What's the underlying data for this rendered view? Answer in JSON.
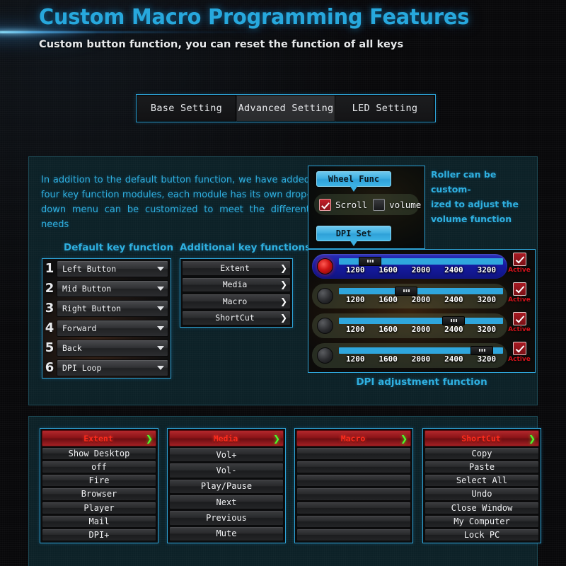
{
  "header": {
    "title": "Custom Macro Programming Features",
    "subtitle": "Custom button function, you can reset the function of all keys",
    "accent_color": "#27a8dd"
  },
  "tabs": [
    {
      "label": "Base Setting",
      "active": false
    },
    {
      "label": "Advanced Setting",
      "active": true
    },
    {
      "label": "LED Setting",
      "active": false
    }
  ],
  "main_panel": {
    "intro_text": "In addition to the default button function, we have added four key function modules, each module has its own drop-down menu can be customized to meet the different needs",
    "default_key_heading": "Default key function",
    "additional_key_heading": "Additional key functions",
    "default_keys": [
      {
        "number": "1",
        "value": "Left Button"
      },
      {
        "number": "2",
        "value": "Mid Button"
      },
      {
        "number": "3",
        "value": "Right Button"
      },
      {
        "number": "4",
        "value": "Forward"
      },
      {
        "number": "5",
        "value": "Back"
      },
      {
        "number": "6",
        "value": "DPI Loop"
      }
    ],
    "additional_functions": [
      {
        "label": "Extent",
        "chevron": "❯"
      },
      {
        "label": "Media",
        "chevron": "❯"
      },
      {
        "label": "Macro",
        "chevron": "❯"
      },
      {
        "label": "ShortCut",
        "chevron": "❯"
      }
    ]
  },
  "wheel_panel": {
    "wheel_button": "Wheel Func",
    "dpi_button": "DPI Set",
    "scroll_label": "Scroll",
    "volume_label": "volume",
    "scroll_checked": true,
    "volume_checked": false,
    "note": "Roller can be custom-ized to adjust the volume function",
    "note_lines": [
      "Roller can be custom-",
      "ized to adjust the",
      "volume function"
    ]
  },
  "dpi_panel": {
    "caption": "DPI adjustment function",
    "tick_labels": [
      "1200",
      "1600",
      "2000",
      "2400",
      "3200"
    ],
    "active_label": "Active",
    "rows": [
      {
        "selected": true,
        "value": "1200",
        "handle_pct": 12,
        "active": true
      },
      {
        "selected": false,
        "value": "1600",
        "handle_pct": 34,
        "active": true
      },
      {
        "selected": false,
        "value": "2400",
        "handle_pct": 63,
        "active": true
      },
      {
        "selected": false,
        "value": "3200",
        "handle_pct": 80,
        "active": true
      }
    ]
  },
  "menu_columns": [
    {
      "title": "Extent",
      "chevron": "❯",
      "truncated": true,
      "items": [
        "Show Desktop",
        "off",
        "Fire",
        "Browser",
        "Player",
        "Mail",
        "DPI+"
      ]
    },
    {
      "title": "Media",
      "chevron": "❯",
      "truncated": false,
      "items": [
        "Vol+",
        "Vol-",
        "Play/Pause",
        "Next",
        "Previous",
        "Mute"
      ]
    },
    {
      "title": "Macro",
      "chevron": "❯",
      "truncated": true,
      "items": [
        "",
        "",
        "",
        "",
        "",
        "",
        ""
      ]
    },
    {
      "title": "ShortCut",
      "chevron": "❯",
      "truncated": true,
      "items": [
        "Copy",
        "Paste",
        "Select All",
        "Undo",
        "Close Window",
        "My Computer",
        "Lock PC"
      ]
    }
  ]
}
